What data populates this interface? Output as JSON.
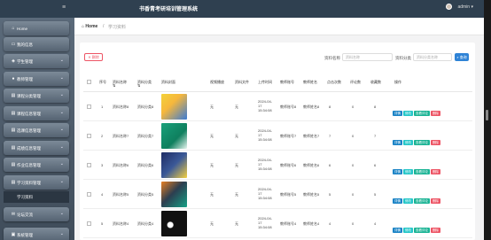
{
  "app": {
    "title": "书香青考研培训管理系统",
    "user_name": "admin"
  },
  "sidebar": {
    "items": [
      {
        "icon": "home-icon",
        "glyph": "⌂",
        "label": "Home",
        "chevron": ""
      },
      {
        "icon": "monitor-icon",
        "glyph": "▭",
        "label": "我的信息",
        "chevron": ""
      },
      {
        "icon": "shield-icon",
        "glyph": "◈",
        "label": "学生管理",
        "chevron": "⌄"
      },
      {
        "icon": "user-icon",
        "glyph": "●",
        "label": "教师管理",
        "chevron": "⌄"
      },
      {
        "icon": "book-icon",
        "glyph": "▤",
        "label": "课程分类管理",
        "chevron": "⌄"
      },
      {
        "icon": "book-icon",
        "glyph": "▤",
        "label": "课程信息管理",
        "chevron": "⌄"
      },
      {
        "icon": "book-icon",
        "glyph": "▤",
        "label": "选课信息管理",
        "chevron": "⌄"
      },
      {
        "icon": "book-icon",
        "glyph": "▤",
        "label": "成绩信息管理",
        "chevron": "⌄"
      },
      {
        "icon": "book-icon",
        "glyph": "▤",
        "label": "作业信息管理",
        "chevron": "⌄"
      },
      {
        "icon": "book-icon",
        "glyph": "▤",
        "label": "学习资料管理",
        "chevron": "⌄"
      }
    ],
    "active_sub": "学习资料",
    "bottom_items": [
      {
        "icon": "chat-icon",
        "glyph": "✉",
        "label": "论坛交流",
        "chevron": "⌄"
      },
      {
        "icon": "settings-icon",
        "glyph": "▣",
        "label": "系统管理",
        "chevron": "⌄"
      }
    ]
  },
  "breadcrumb": {
    "home": "Home",
    "separator": "/",
    "current": "学习资料"
  },
  "toolbar": {
    "delete_label": "删除",
    "name_label": "资料名称",
    "name_placeholder": "资料名称",
    "category_label": "资料分类",
    "category_placeholder": "资料分类名称",
    "search_label": "查询"
  },
  "table": {
    "headers": {
      "seq": "序号",
      "name": "资料名称",
      "category": "资料分类",
      "cover": "资料封面",
      "video": "视频播放",
      "file": "资料文件",
      "upload_time": "上传时间",
      "teacher_id": "教师账号",
      "teacher_name": "教师姓名",
      "clicks": "点击次数",
      "comments": "评论数",
      "favorites": "收藏数",
      "ops": "操作"
    },
    "rows": [
      {
        "seq": "1",
        "name": "资料名称8",
        "category": "资料分类8",
        "video": "无",
        "file": "无",
        "time": "2024-04-17 15:34:08",
        "teacher_id": "教师账号8",
        "teacher_name": "教师姓名8",
        "clicks": "8",
        "comments": "0",
        "favorites": "8"
      },
      {
        "seq": "2",
        "name": "资料名称7",
        "category": "资料分类7",
        "video": "无",
        "file": "无",
        "time": "2024-04-17 15:34:08",
        "teacher_id": "教师账号7",
        "teacher_name": "教师姓名7",
        "clicks": "7",
        "comments": "0",
        "favorites": "7"
      },
      {
        "seq": "3",
        "name": "资料名称6",
        "category": "资料分类6",
        "video": "无",
        "file": "无",
        "time": "2024-04-17 15:34:08",
        "teacher_id": "教师账号6",
        "teacher_name": "教师姓名6",
        "clicks": "6",
        "comments": "0",
        "favorites": "6"
      },
      {
        "seq": "4",
        "name": "资料名称5",
        "category": "资料分类5",
        "video": "无",
        "file": "无",
        "time": "2024-04-17 15:34:08",
        "teacher_id": "教师账号5",
        "teacher_name": "教师姓名5",
        "clicks": "5",
        "comments": "0",
        "favorites": "5"
      },
      {
        "seq": "5",
        "name": "资料名称4",
        "category": "资料分类4",
        "video": "无",
        "file": "无",
        "time": "2024-04-17 15:34:08",
        "teacher_id": "教师账号4",
        "teacher_name": "教师姓名4",
        "clicks": "4",
        "comments": "0",
        "favorites": "4"
      }
    ],
    "ops": {
      "detail": "详情",
      "edit": "修改",
      "comment": "查看评论",
      "remove": "删除"
    }
  },
  "colors": {
    "topbar": "#2f4050",
    "primary": "#2f83d6",
    "danger": "#ed5565",
    "info": "#23c6c8",
    "success": "#1ab394"
  }
}
